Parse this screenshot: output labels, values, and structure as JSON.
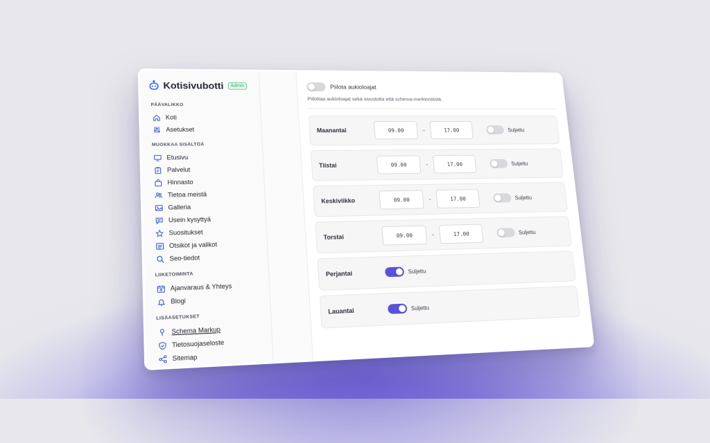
{
  "brand": {
    "name": "Kotisivubotti",
    "badge": "Admin"
  },
  "sidebar": {
    "sections": [
      {
        "title": "PÄÄVALIKKO",
        "items": [
          {
            "label": "Koti",
            "icon": "home-icon"
          },
          {
            "label": "Asetukset",
            "icon": "sliders-icon"
          }
        ]
      },
      {
        "title": "MUOKKAA SISÄLTÖÄ",
        "items": [
          {
            "label": "Etusivu",
            "icon": "monitor-icon"
          },
          {
            "label": "Palvelut",
            "icon": "clipboard-icon"
          },
          {
            "label": "Hinnasto",
            "icon": "bag-icon"
          },
          {
            "label": "Tietoa meistä",
            "icon": "users-icon"
          },
          {
            "label": "Galleria",
            "icon": "image-icon"
          },
          {
            "label": "Usein kysyttyä",
            "icon": "chat-icon"
          },
          {
            "label": "Suositukset",
            "icon": "star-icon"
          },
          {
            "label": "Otsikot ja valikot",
            "icon": "list-icon"
          },
          {
            "label": "Seo-tiedot",
            "icon": "search-icon"
          }
        ]
      },
      {
        "title": "LIIKETOIMINTA",
        "items": [
          {
            "label": "Ajanvaraus & Yhteys",
            "icon": "calendar-icon"
          },
          {
            "label": "Blogi",
            "icon": "bell-icon"
          }
        ]
      },
      {
        "title": "LISÄASETUKSET",
        "items": [
          {
            "label": "Schema Markup",
            "icon": "pin-icon"
          },
          {
            "label": "Tietosuojaseloste",
            "icon": "shield-icon"
          },
          {
            "label": "Sitemap",
            "icon": "share-icon"
          }
        ]
      }
    ]
  },
  "main": {
    "hide_label": "Piilota aukioloajat",
    "hide_description": "Piilottaa aukioloajat sekä sivustolta että schema-merkinnöistä.",
    "closed_label": "Suljettu",
    "separator": "-",
    "days": [
      {
        "name": "Maanantai",
        "open": "09.00",
        "close": "17.00",
        "closed": false
      },
      {
        "name": "Tiistai",
        "open": "09.00",
        "close": "17.00",
        "closed": false
      },
      {
        "name": "Keskiviikko",
        "open": "09.00",
        "close": "17.00",
        "closed": false
      },
      {
        "name": "Torstai",
        "open": "09.00",
        "close": "17.00",
        "closed": false
      },
      {
        "name": "Perjantai",
        "closed": true
      },
      {
        "name": "Lauantai",
        "closed": true
      }
    ]
  },
  "colors": {
    "accent": "#5b52d8",
    "badge": "#2f9e6a"
  }
}
